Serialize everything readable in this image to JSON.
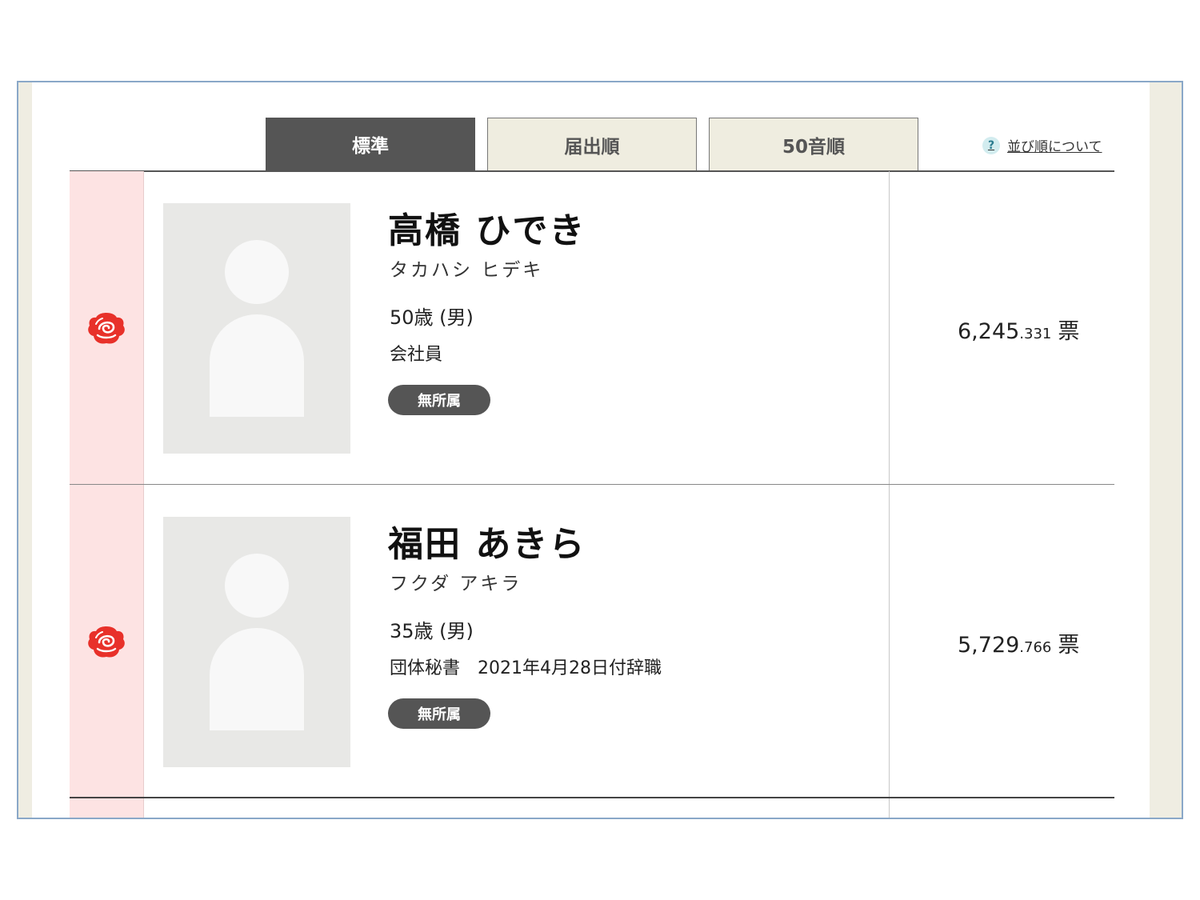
{
  "tabs": [
    {
      "label": "標準",
      "active": true
    },
    {
      "label": "届出順",
      "active": false
    },
    {
      "label": "50音順",
      "active": false
    }
  ],
  "sort_help": {
    "icon": "?",
    "label": "並び順について"
  },
  "colors": {
    "accent_rose": "#e8312a",
    "tab_active_bg": "#555555",
    "elected_bg": "#fde3e3"
  },
  "candidates": [
    {
      "elected_icon": "rose-icon",
      "name": "高橋 ひでき",
      "kana": "タカハシ ヒデキ",
      "age": "50歳 (男)",
      "job": "会社員",
      "party": "無所属",
      "votes_int": "6,245",
      "votes_frac": ".331",
      "votes_unit": "票"
    },
    {
      "elected_icon": "rose-icon",
      "name": "福田 あきら",
      "kana": "フクダ アキラ",
      "age": "35歳 (男)",
      "job": "団体秘書　2021年4月28日付辞職",
      "party": "無所属",
      "votes_int": "5,729",
      "votes_frac": ".766",
      "votes_unit": "票"
    }
  ]
}
